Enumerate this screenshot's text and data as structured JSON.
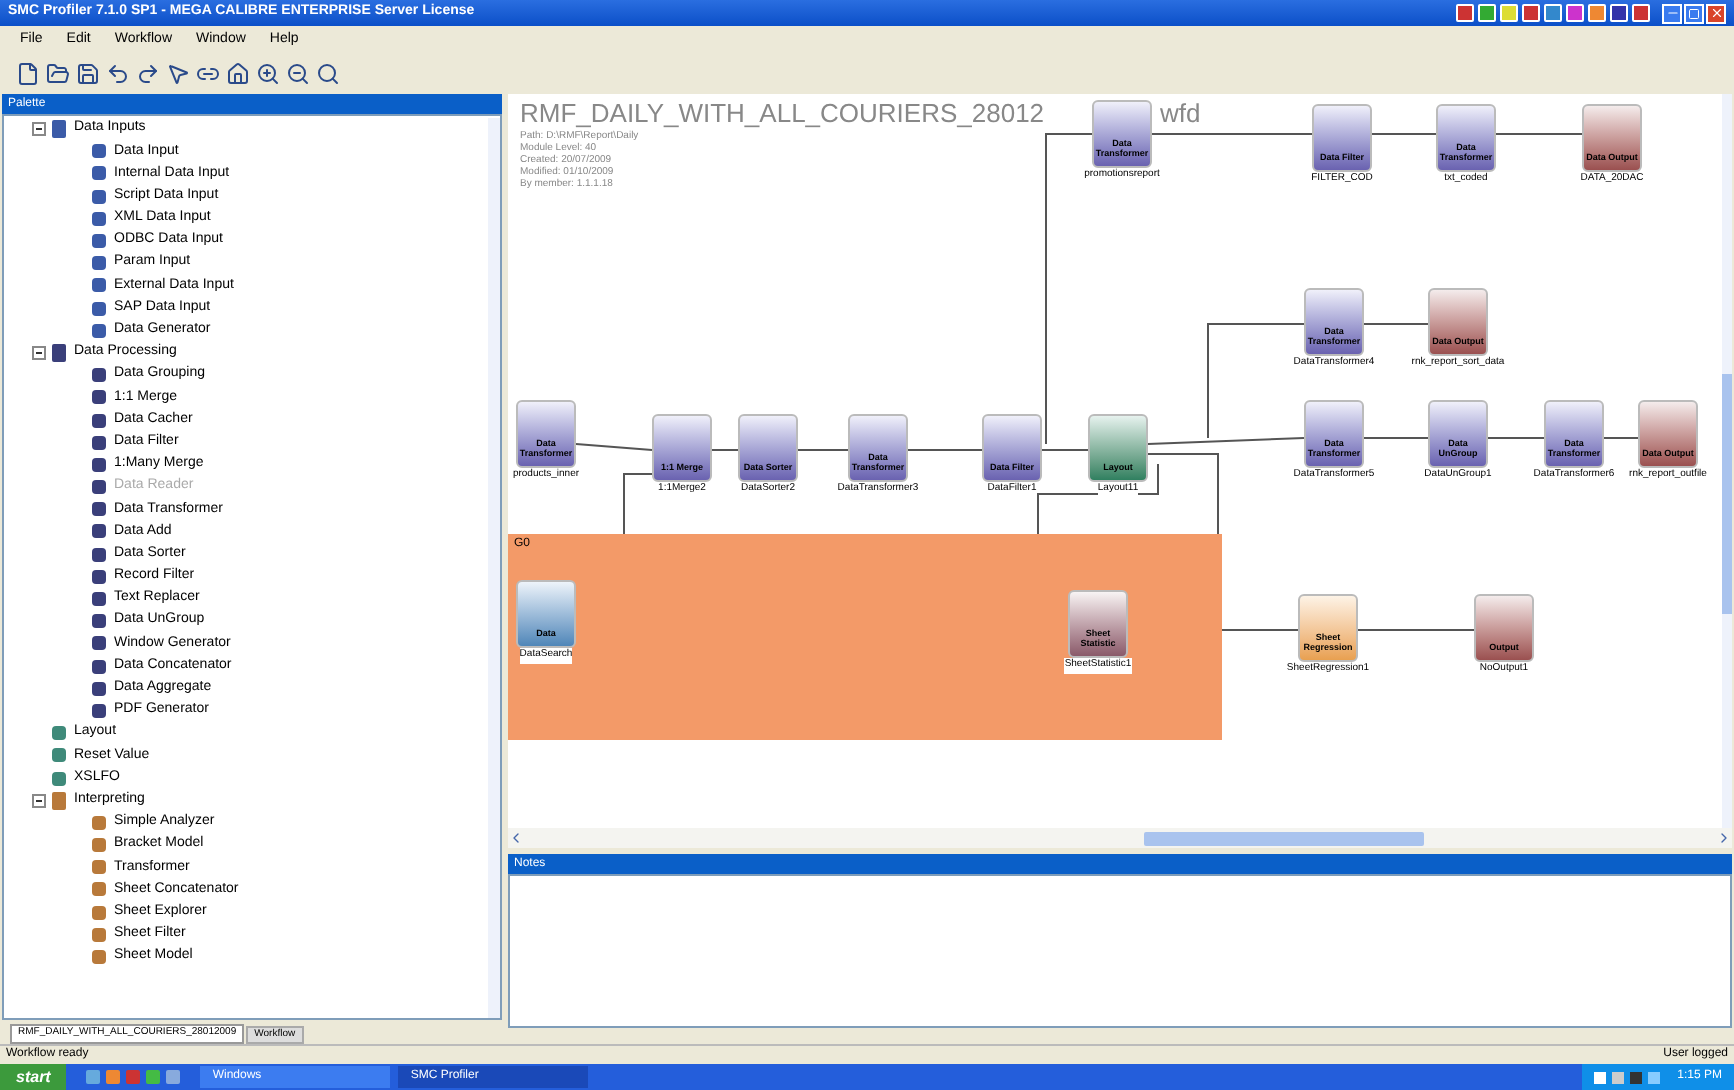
{
  "window": {
    "title": "SMC Profiler 7.1.0 SP1 - MEGA CALIBRE ENTERPRISE Server License"
  },
  "menu": [
    "File",
    "Edit",
    "Workflow",
    "Window",
    "Help"
  ],
  "palette": {
    "title": "Palette",
    "tree": [
      {
        "label": "Data Inputs",
        "kind": "input",
        "expanded": true,
        "children": [
          {
            "label": "Data Input",
            "kind": "input",
            "disabled": false
          },
          {
            "label": "Internal Data Input",
            "kind": "input",
            "disabled": false
          },
          {
            "label": "Script Data Input",
            "kind": "input",
            "disabled": false
          },
          {
            "label": "XML Data Input",
            "kind": "input",
            "disabled": false
          },
          {
            "label": "ODBC Data Input",
            "kind": "input",
            "disabled": false
          },
          {
            "label": "Param Input",
            "kind": "input",
            "disabled": false
          },
          {
            "label": "External Data Input",
            "kind": "input",
            "disabled": false
          },
          {
            "label": "SAP Data Input",
            "kind": "input",
            "disabled": false
          },
          {
            "label": "Data Generator",
            "kind": "input",
            "disabled": false
          }
        ]
      },
      {
        "label": "Data Processing",
        "kind": "processing",
        "expanded": true,
        "children": [
          {
            "label": "Data Grouping",
            "kind": "processing",
            "disabled": false
          },
          {
            "label": "1:1 Merge",
            "kind": "processing",
            "disabled": false
          },
          {
            "label": "Data Cacher",
            "kind": "processing",
            "disabled": false
          },
          {
            "label": "Data Filter",
            "kind": "processing",
            "disabled": false
          },
          {
            "label": "1:Many Merge",
            "kind": "processing",
            "disabled": false
          },
          {
            "label": "Data Reader",
            "kind": "processing",
            "disabled": true
          },
          {
            "label": "Data Transformer",
            "kind": "processing",
            "disabled": false
          },
          {
            "label": "Data Add",
            "kind": "processing",
            "disabled": false
          },
          {
            "label": "Data Sorter",
            "kind": "processing",
            "disabled": false
          },
          {
            "label": "Record Filter",
            "kind": "processing",
            "disabled": false
          },
          {
            "label": "Text Replacer",
            "kind": "processing",
            "disabled": false
          },
          {
            "label": "Data UnGroup",
            "kind": "processing",
            "disabled": false
          },
          {
            "label": "Window Generator",
            "kind": "processing",
            "disabled": false
          },
          {
            "label": "Data Concatenator",
            "kind": "processing",
            "disabled": false
          },
          {
            "label": "Data Aggregate",
            "kind": "processing",
            "disabled": false
          },
          {
            "label": "PDF Generator",
            "kind": "processing",
            "disabled": false
          }
        ]
      },
      {
        "label": "Layout",
        "kind": "layout",
        "disabled": false
      },
      {
        "label": "Reset Value",
        "kind": "layout",
        "disabled": false
      },
      {
        "label": "XSLFO",
        "kind": "layout",
        "disabled": false
      },
      {
        "label": "Interpreting",
        "kind": "interpreting",
        "expanded": true,
        "children": [
          {
            "label": "Simple Analyzer",
            "kind": "interpreting",
            "disabled": false
          },
          {
            "label": "Bracket Model",
            "kind": "interpreting",
            "disabled": false
          },
          {
            "label": "Transformer",
            "kind": "interpreting",
            "disabled": false
          },
          {
            "label": "Sheet Concatenator",
            "kind": "interpreting",
            "disabled": false
          },
          {
            "label": "Sheet Explorer",
            "kind": "interpreting",
            "disabled": false
          },
          {
            "label": "Sheet Filter",
            "kind": "interpreting",
            "disabled": false
          },
          {
            "label": "Sheet Model",
            "kind": "interpreting",
            "disabled": false
          }
        ]
      }
    ]
  },
  "editor_tabs": [
    {
      "label": "RMF_DAILY_WITH_ALL_COURIERS_28012009",
      "selected": true
    },
    {
      "label": "Workflow",
      "selected": false
    }
  ],
  "canvas": {
    "title": "RMF_DAILY_WITH_ALL_COURIERS_28012",
    "title_suffix": "wfd",
    "info": [
      "Path: D:\\RMF\\Report\\Daily",
      "Module Level: 40",
      "Created: 20/07/2009",
      "Modified: 01/10/2009",
      "By member: 1.1.1.18"
    ],
    "group": {
      "label": "G0"
    },
    "nodes": [
      {
        "kind": "transformer",
        "text": "Data Transformer",
        "name": "promotionsreport"
      },
      {
        "kind": "transformer",
        "text": "Data Filter",
        "name": "FILTER_COD"
      },
      {
        "kind": "transformer",
        "text": "Data Transformer",
        "name": "txt_coded"
      },
      {
        "kind": "output",
        "text": "Data Output",
        "name": "DATA_20DAC"
      },
      {
        "kind": "transformer",
        "text": "Data Transformer",
        "name": "DataTransformer4"
      },
      {
        "kind": "output",
        "text": "Data Output",
        "name": "rnk_report_sort_data"
      },
      {
        "kind": "transformer",
        "text": "Data Transformer",
        "name": "products_inner"
      },
      {
        "kind": "transformer",
        "text": "1:1 Merge",
        "name": "1:1Merge2"
      },
      {
        "kind": "transformer",
        "text": "Data Sorter",
        "name": "DataSorter2"
      },
      {
        "kind": "transformer",
        "text": "Data Transformer",
        "name": "DataTransformer3"
      },
      {
        "kind": "transformer",
        "text": "Data Filter",
        "name": "DataFilter1"
      },
      {
        "kind": "layout",
        "text": "Layout",
        "name": "Layout11"
      },
      {
        "kind": "transformer",
        "text": "Data Transformer",
        "name": "DataTransformer5"
      },
      {
        "kind": "transformer",
        "text": "Data UnGroup",
        "name": "DataUnGroup1"
      },
      {
        "kind": "transformer",
        "text": "Data Transformer",
        "name": "DataTransformer6"
      },
      {
        "kind": "output",
        "text": "Data Output",
        "name": "rnk_report_outfile"
      },
      {
        "kind": "input",
        "text": "Data",
        "name": "DataSearch"
      },
      {
        "kind": "sheet",
        "text": "Sheet Statistic",
        "name": "SheetStatistic1"
      },
      {
        "kind": "regression",
        "text": "Sheet Regression",
        "name": "SheetRegression1"
      },
      {
        "kind": "output",
        "text": "Output",
        "name": "NoOutput1"
      }
    ]
  },
  "notes_panel": {
    "title": "Notes"
  },
  "status_bar": {
    "left": "Workflow ready",
    "right": "User logged"
  },
  "taskbar": {
    "start": "start",
    "tasks": [
      {
        "label": "Windows",
        "selected": false
      },
      {
        "label": "SMC Profiler",
        "selected": true
      }
    ],
    "clock": "1:15 PM"
  }
}
